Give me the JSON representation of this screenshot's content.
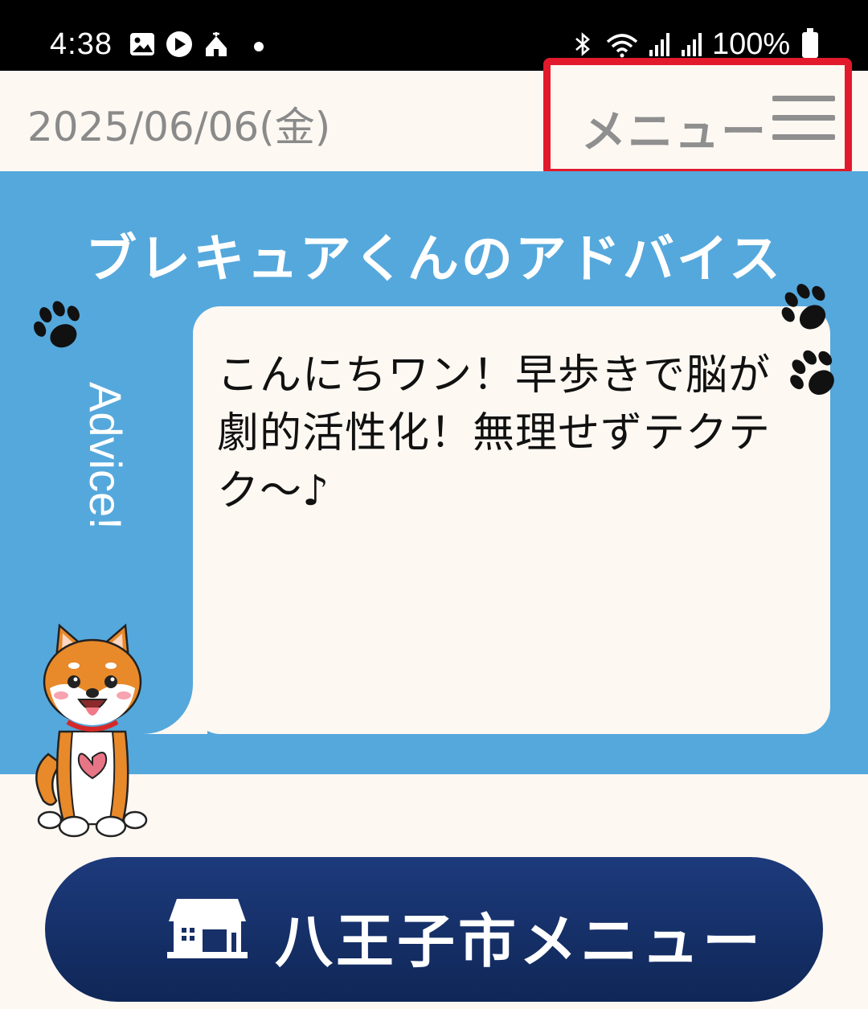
{
  "status_bar": {
    "time": "4:38",
    "icons": [
      "gallery-icon",
      "play-store-icon",
      "tent-icon",
      "notification-dot",
      "bluetooth-icon",
      "wifi-icon",
      "signal-icon",
      "signal-icon"
    ],
    "battery": "100%"
  },
  "header": {
    "date": "2025/06/06(金)",
    "menu_label": "メニュー",
    "highlight_color": "#e21a2c"
  },
  "advice": {
    "title": "ブレキュアくんのアドバイス",
    "side_label": "Advice!",
    "message": "こんにちワン！早歩きで脳が劇的活性化！無理せずテクテク～♪",
    "panel_color": "#55a8dc"
  },
  "footer": {
    "city_menu_label": "八王子市メニュー",
    "button_color": "#173068"
  }
}
